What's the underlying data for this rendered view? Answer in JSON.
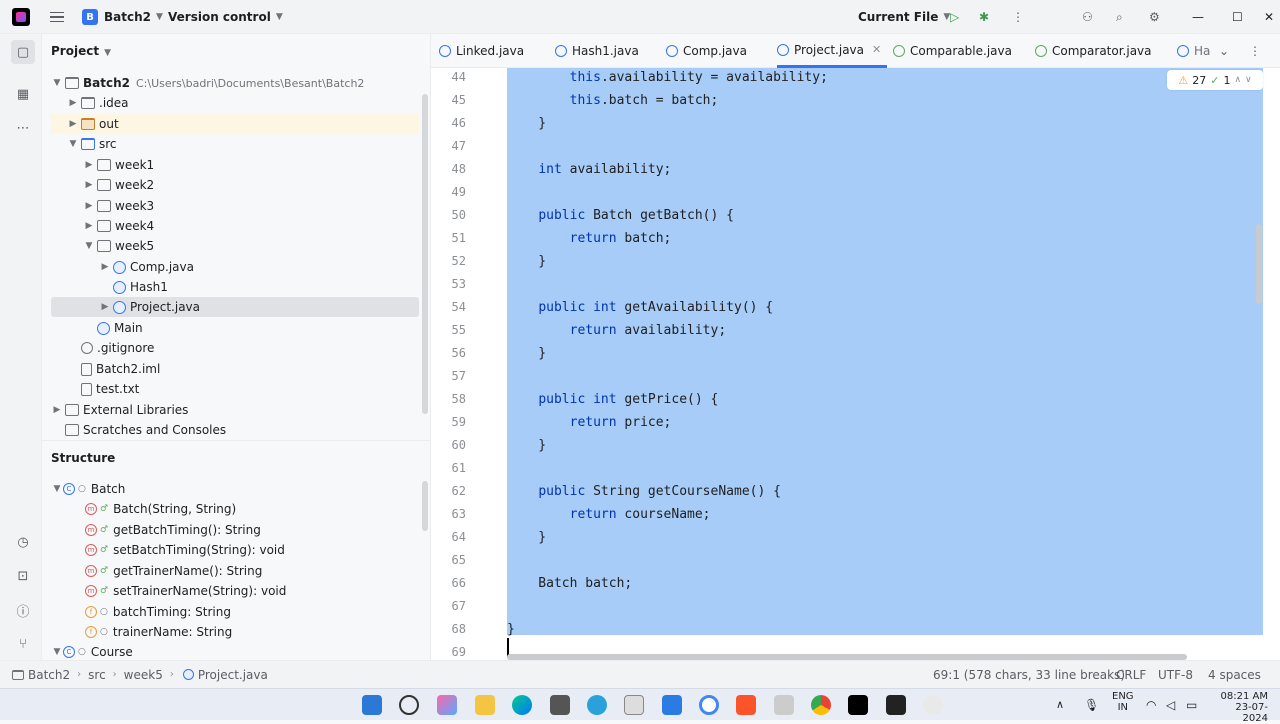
{
  "titlebar": {
    "project_initial": "B",
    "project_name": "Batch2",
    "vcs_label": "Version control",
    "run_config": "Current File"
  },
  "project_panel": {
    "title": "Project",
    "tree": [
      {
        "label": "Batch2",
        "path": "C:\\Users\\badri\\Documents\\Besant\\Batch2"
      },
      {
        "label": ".idea"
      },
      {
        "label": "out"
      },
      {
        "label": "src"
      },
      {
        "label": "week1"
      },
      {
        "label": "week2"
      },
      {
        "label": "week3"
      },
      {
        "label": "week4"
      },
      {
        "label": "week5"
      },
      {
        "label": "Comp.java"
      },
      {
        "label": "Hash1"
      },
      {
        "label": "Project.java"
      },
      {
        "label": "Main"
      },
      {
        "label": ".gitignore"
      },
      {
        "label": "Batch2.iml"
      },
      {
        "label": "test.txt"
      },
      {
        "label": "External Libraries"
      },
      {
        "label": "Scratches and Consoles"
      }
    ]
  },
  "structure_panel": {
    "title": "Structure",
    "items": [
      {
        "label": "Batch",
        "kind": "class"
      },
      {
        "label": "Batch(String, String)",
        "kind": "method"
      },
      {
        "label": "getBatchTiming(): String",
        "kind": "method"
      },
      {
        "label": "setBatchTiming(String): void",
        "kind": "method"
      },
      {
        "label": "getTrainerName(): String",
        "kind": "method"
      },
      {
        "label": "setTrainerName(String): void",
        "kind": "method"
      },
      {
        "label": "batchTiming: String",
        "kind": "field"
      },
      {
        "label": "trainerName: String",
        "kind": "field"
      },
      {
        "label": "Course",
        "kind": "class"
      }
    ]
  },
  "editor": {
    "tabs": [
      {
        "label": "Linked.java"
      },
      {
        "label": "Hash1.java"
      },
      {
        "label": "Comp.java"
      },
      {
        "label": "Project.java",
        "active": true
      },
      {
        "label": "Comparable.java"
      },
      {
        "label": "Comparator.java"
      },
      {
        "label": "Ha"
      }
    ],
    "inspections": {
      "warnings": "27",
      "ok": "1"
    },
    "line_numbers": [
      "44",
      "45",
      "46",
      "47",
      "48",
      "49",
      "50",
      "51",
      "52",
      "53",
      "54",
      "55",
      "56",
      "57",
      "58",
      "59",
      "60",
      "61",
      "62",
      "63",
      "64",
      "65",
      "66",
      "67",
      "68",
      "69"
    ],
    "lines": [
      "        this.availability = availability;",
      "        this.batch = batch;",
      "    }",
      "",
      "    int availability;",
      "",
      "    public Batch getBatch() {",
      "        return batch;",
      "    }",
      "",
      "    public int getAvailability() {",
      "        return availability;",
      "    }",
      "",
      "    public int getPrice() {",
      "        return price;",
      "    }",
      "",
      "    public String getCourseName() {",
      "        return courseName;",
      "    }",
      "",
      "    Batch batch;",
      "",
      "}",
      ""
    ]
  },
  "statusbar": {
    "breadcrumbs": [
      "Batch2",
      "src",
      "week5",
      "Project.java"
    ],
    "position": "69:1 (578 chars, 33 line breaks)",
    "line_ending": "CRLF",
    "encoding": "UTF-8",
    "indent": "4 spaces"
  },
  "taskbar": {
    "lang": "ENG",
    "lang_sub": "IN",
    "time": "08:21 AM",
    "date": "23-07-2024"
  },
  "colors": {
    "selection": "#a6ccf7",
    "accent": "#3574f0",
    "keyword": "#0033b3"
  }
}
